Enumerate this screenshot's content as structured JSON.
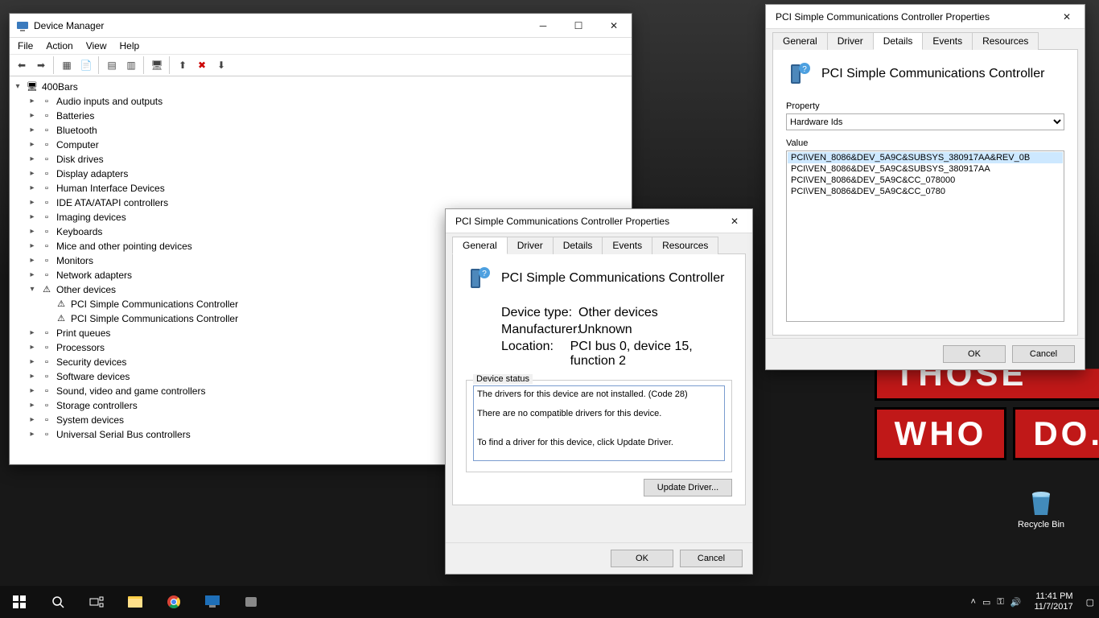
{
  "devmgr": {
    "title": "Device Manager",
    "menu": [
      "File",
      "Action",
      "View",
      "Help"
    ],
    "root": "400Bars",
    "items": [
      "Audio inputs and outputs",
      "Batteries",
      "Bluetooth",
      "Computer",
      "Disk drives",
      "Display adapters",
      "Human Interface Devices",
      "IDE ATA/ATAPI controllers",
      "Imaging devices",
      "Keyboards",
      "Mice and other pointing devices",
      "Monitors",
      "Network adapters",
      "Other devices",
      "Print queues",
      "Processors",
      "Security devices",
      "Software devices",
      "Sound, video and game controllers",
      "Storage controllers",
      "System devices",
      "Universal Serial Bus controllers"
    ],
    "other_children": [
      "PCI Simple Communications Controller",
      "PCI Simple Communications Controller"
    ]
  },
  "general": {
    "title": "PCI Simple Communications Controller Properties",
    "tabs": [
      "General",
      "Driver",
      "Details",
      "Events",
      "Resources"
    ],
    "device_name": "PCI Simple Communications Controller",
    "type_k": "Device type:",
    "type_v": "Other devices",
    "mfr_k": "Manufacturer:",
    "mfr_v": "Unknown",
    "loc_k": "Location:",
    "loc_v": "PCI bus 0, device 15, function 2",
    "status_legend": "Device status",
    "status_text": "The drivers for this device are not installed. (Code 28)\n\nThere are no compatible drivers for this device.\n\n\nTo find a driver for this device, click Update Driver.",
    "update_btn": "Update Driver...",
    "ok": "OK",
    "cancel": "Cancel"
  },
  "details": {
    "title": "PCI Simple Communications Controller Properties",
    "tabs": [
      "General",
      "Driver",
      "Details",
      "Events",
      "Resources"
    ],
    "device_name": "PCI Simple Communications Controller",
    "prop_label": "Property",
    "prop_value": "Hardware Ids",
    "value_label": "Value",
    "values": [
      "PCI\\VEN_8086&DEV_5A9C&SUBSYS_380917AA&REV_0B",
      "PCI\\VEN_8086&DEV_5A9C&SUBSYS_380917AA",
      "PCI\\VEN_8086&DEV_5A9C&CC_078000",
      "PCI\\VEN_8086&DEV_5A9C&CC_0780"
    ],
    "ok": "OK",
    "cancel": "Cancel"
  },
  "desktop": {
    "bg_text_top": "THOSE",
    "bg_text_mid": "WHO",
    "bg_text_bot": "DO.",
    "recycle": "Recycle Bin"
  },
  "taskbar": {
    "time": "11:41 PM",
    "date": "11/7/2017"
  }
}
